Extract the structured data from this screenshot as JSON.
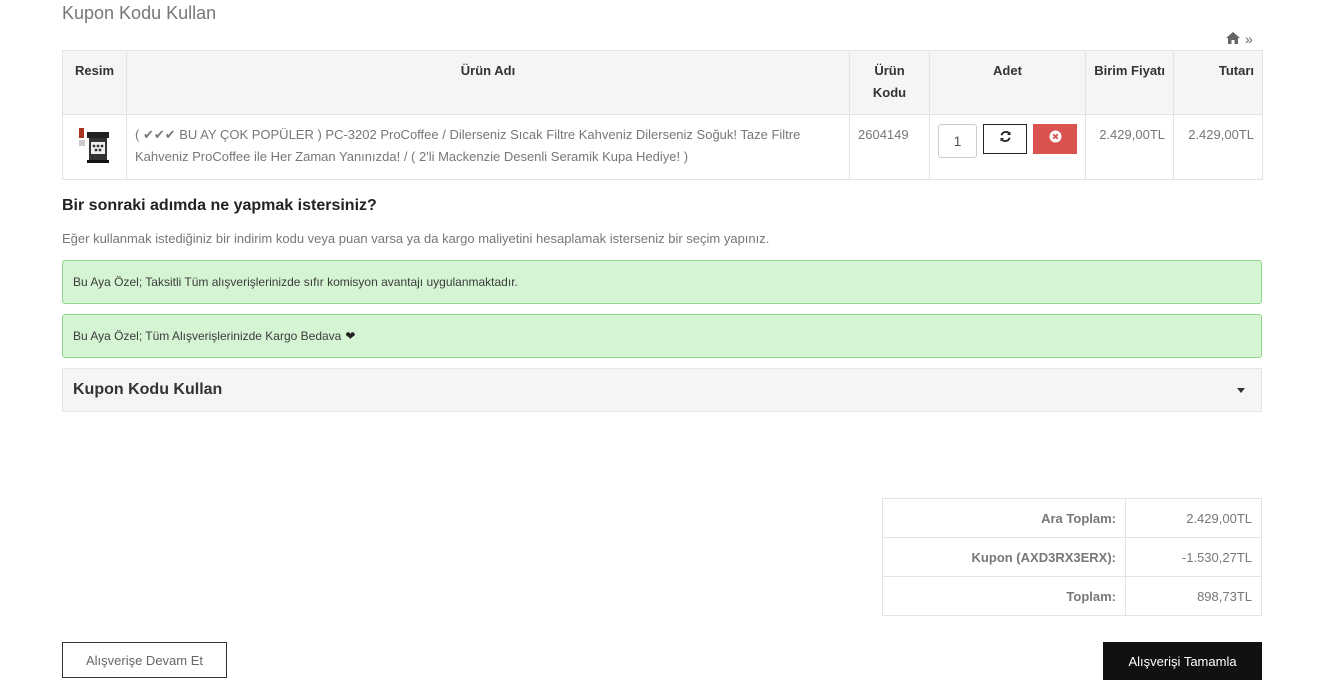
{
  "page": {
    "heading": "Kupon Kodu Kullan",
    "breadcrumb": {
      "separator": "»",
      "home_icon": "home-icon"
    }
  },
  "cart": {
    "headers": {
      "image": "Resim",
      "name": "Ürün Adı",
      "code": "Ürün Kodu",
      "quantity": "Adet",
      "unit_price": "Birim Fiyatı",
      "total": "Tutarı"
    },
    "items": [
      {
        "name": "( ✔✔✔ BU AY ÇOK POPÜLER ) PC-3202 ProCoffee / Dilerseniz Sıcak Filtre Kahveniz Dilerseniz Soğuk! Taze Filtre Kahveniz ProCoffee ile Her Zaman Yanınızda! / ( 2'li Mackenzie Desenli Seramik Kupa Hediye! )",
        "code": "2604149",
        "quantity": "1",
        "unit_price": "2.429,00TL",
        "total": "2.429,00TL",
        "image_icon": "coffee-machine-icon"
      }
    ],
    "icons": {
      "refresh": "refresh-icon",
      "remove": "remove-icon"
    },
    "colors": {
      "remove_button": "#d9534f"
    }
  },
  "next_step": {
    "title": "Bir sonraki adımda ne yapmak istersiniz?",
    "description": "Eğer kullanmak istediğiniz bir indirim kodu veya puan varsa ya da kargo maliyetini hesaplamak isterseniz bir seçim yapınız."
  },
  "alerts": [
    {
      "text": "Bu Aya Özel; Taksitli Tüm alışverişlerinizde sıfır komisyon avantajı uygulanmaktadır."
    },
    {
      "text": "Bu Aya Özel; Tüm Alışverişlerinizde Kargo Bedava",
      "suffix": "❤"
    }
  ],
  "alert_colors": {
    "background": "#d4f4d3",
    "border": "#8fd68c"
  },
  "coupon": {
    "title": "Kupon Kodu Kullan"
  },
  "totals": [
    {
      "label": "Ara Toplam:",
      "value": "2.429,00TL"
    },
    {
      "label": "Kupon (AXD3RX3ERX):",
      "value": "-1.530,27TL"
    },
    {
      "label": "Toplam:",
      "value": "898,73TL"
    }
  ],
  "actions": {
    "continue_label": "Alışverişe Devam Et",
    "checkout_label": "Alışverişi Tamamla"
  }
}
